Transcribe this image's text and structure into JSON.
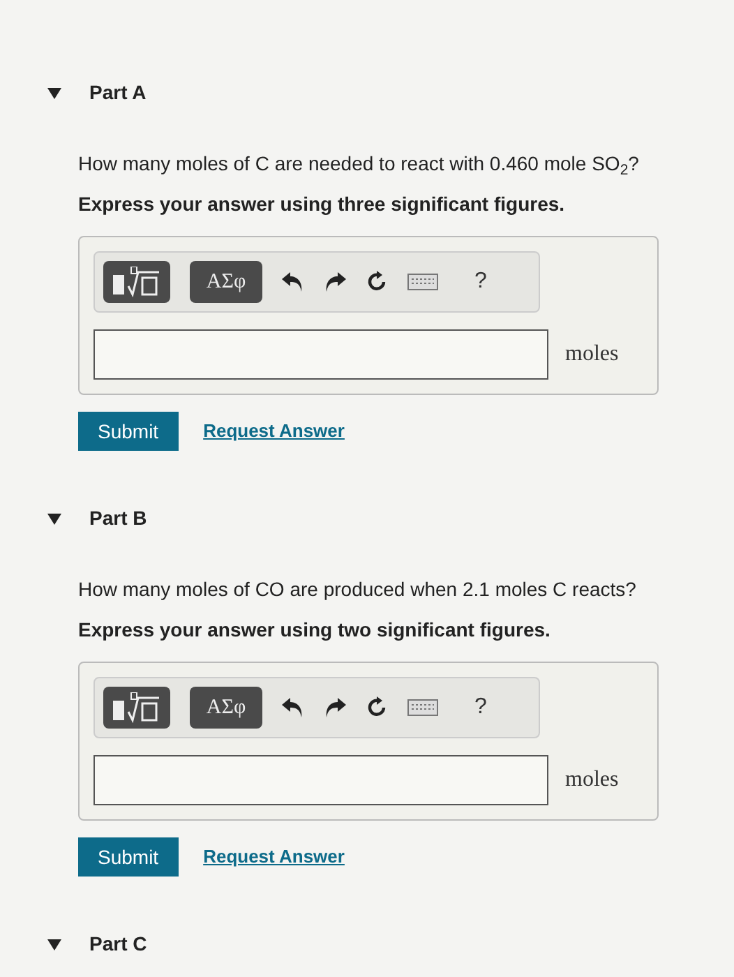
{
  "parts": [
    {
      "title": "Part A",
      "expanded": true,
      "question": "How many moles of C are needed to react with 0.460 mole SO$_{2}$?",
      "instruction": "Express your answer using three significant figures.",
      "toolbar": {
        "symbols_button": "ΑΣφ",
        "help": "?"
      },
      "answer": {
        "unit": "moles"
      },
      "submit": "Submit",
      "request": "Request Answer"
    },
    {
      "title": "Part B",
      "expanded": true,
      "question": "How many moles of CO are produced when 2.1 moles C reacts?",
      "instruction": "Express your answer using two significant figures.",
      "toolbar": {
        "symbols_button": "ΑΣφ",
        "help": "?"
      },
      "answer": {
        "unit": "moles"
      },
      "submit": "Submit",
      "request": "Request Answer"
    },
    {
      "title": "Part C",
      "expanded": true
    }
  ]
}
